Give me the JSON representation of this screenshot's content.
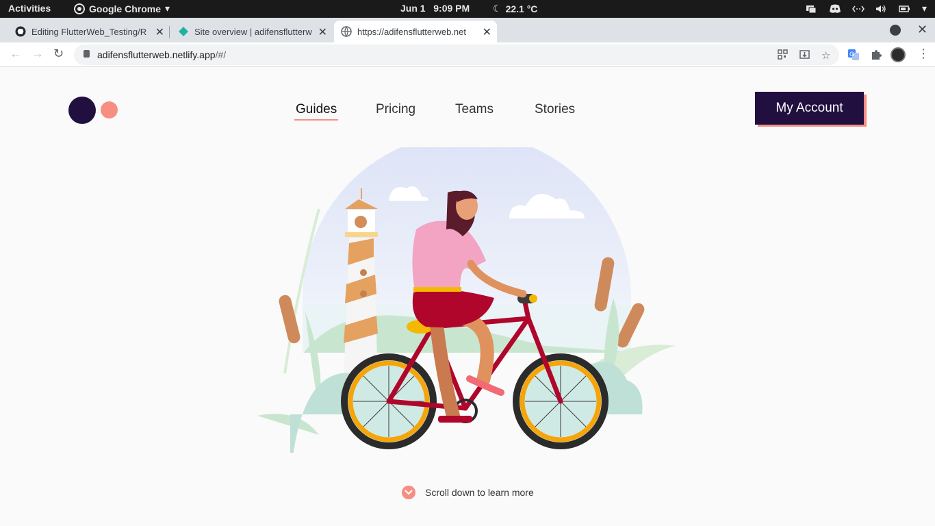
{
  "system": {
    "activities": "Activities",
    "app_name": "Google Chrome",
    "date": "Jun 1",
    "time": "9:09 PM",
    "weather": "22.1 °C"
  },
  "tabs": [
    {
      "title": "Editing FlutterWeb_Testing/R",
      "icon": "github-icon"
    },
    {
      "title": "Site overview | adifensflutterw",
      "icon": "netlify-icon"
    },
    {
      "title": "https://adifensflutterweb.net",
      "icon": "globe-icon"
    }
  ],
  "address": {
    "host": "adifensflutterweb.netlify.app",
    "path": "/#/"
  },
  "site": {
    "nav": [
      "Guides",
      "Pricing",
      "Teams",
      "Stories"
    ],
    "account_label": "My Account",
    "scroll_label": "Scroll down to learn more"
  },
  "colors": {
    "brand_dark": "#200f3f",
    "brand_accent": "#f68f82"
  }
}
